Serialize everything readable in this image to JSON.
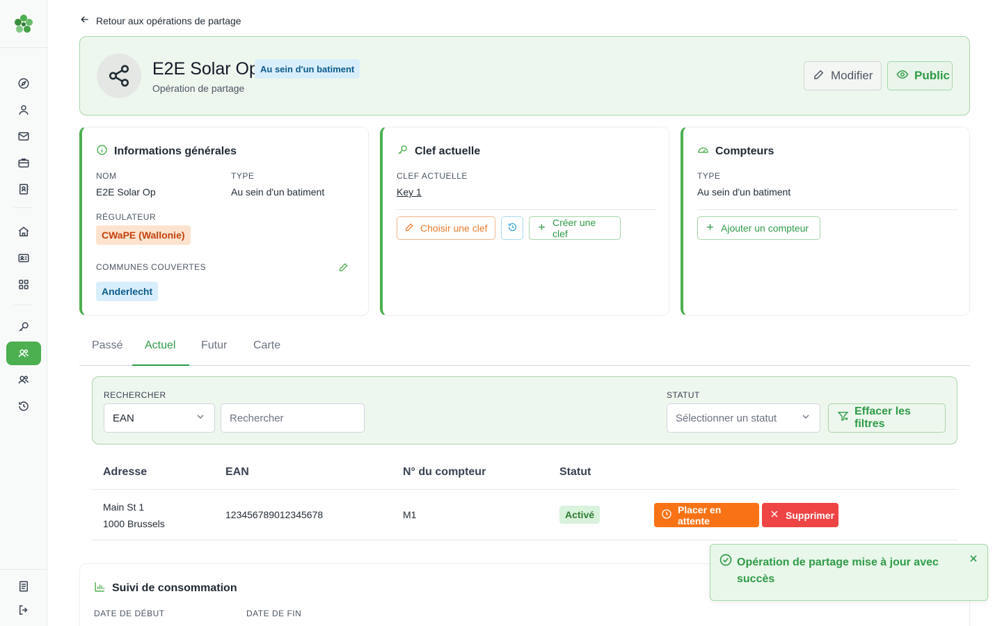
{
  "sidebar": {
    "brand_color": "#4caf50",
    "icons": [
      "compass-icon",
      "user-icon",
      "mail-icon",
      "briefcase-icon",
      "contact-book-icon",
      "home-icon",
      "id-card-icon",
      "grid-icon",
      "key-icon",
      "sharing-users-icon",
      "users-icon",
      "history-icon",
      "document-icon",
      "logout-icon"
    ],
    "active": "sharing-users-icon"
  },
  "back_link": "Retour aux opérations de partage",
  "header": {
    "title": "E2E Solar Op",
    "badge": "Au sein d'un batiment",
    "subtitle": "Opération de partage",
    "modify_label": "Modifier",
    "public_label": "Public"
  },
  "general_info": {
    "title": "Informations générales",
    "name_label": "NOM",
    "name_value": "E2E Solar Op",
    "type_label": "TYPE",
    "type_value": "Au sein d'un batiment",
    "regulator_label": "RÉGULATEUR",
    "regulator_value": "CWaPE (Wallonie)",
    "communes_label": "COMMUNES COUVERTES",
    "communes": [
      "Anderlecht"
    ]
  },
  "current_key": {
    "title": "Clef actuelle",
    "label": "CLEF ACTUELLE",
    "value": "Key 1",
    "choose_label": "Choisir une clef",
    "create_label": "Créer une clef"
  },
  "meters": {
    "title": "Compteurs",
    "type_label": "TYPE",
    "type_value": "Au sein d'un batiment",
    "add_label": "Ajouter un compteur"
  },
  "tabs": [
    {
      "label": "Passé",
      "active": false
    },
    {
      "label": "Actuel",
      "active": true
    },
    {
      "label": "Futur",
      "active": false
    },
    {
      "label": "Carte",
      "active": false
    }
  ],
  "filters": {
    "search_label": "RECHERCHER",
    "search_field_value": "EAN",
    "search_placeholder": "Rechercher",
    "status_label": "STATUT",
    "status_placeholder": "Sélectionner un statut",
    "clear_label": "Effacer les filtres"
  },
  "table": {
    "headers": [
      "Adresse",
      "EAN",
      "N° du compteur",
      "Statut"
    ],
    "rows": [
      {
        "address_line1": "Main St 1",
        "address_line2": "1000 Brussels",
        "ean": "123456789012345678",
        "meter": "M1",
        "status": "Activé",
        "hold_label": "Placer en attente",
        "delete_label": "Supprimer"
      }
    ]
  },
  "consumption": {
    "title": "Suivi de consommation",
    "start_label": "DATE DE DÉBUT",
    "end_label": "DATE DE FIN"
  },
  "toast": {
    "message": "Opération de partage mise à jour avec succès"
  }
}
